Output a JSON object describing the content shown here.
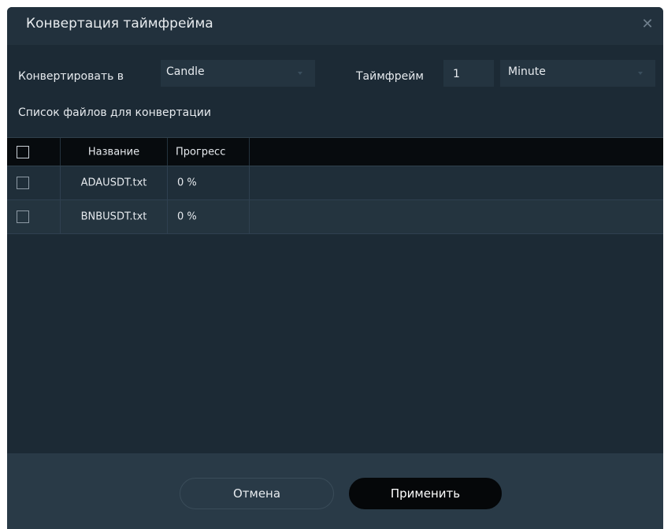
{
  "dialog": {
    "title": "Конвертация таймфрейма",
    "close_icon": "close-icon"
  },
  "convert": {
    "label": "Конвертировать в",
    "value": "Candle"
  },
  "timeframe": {
    "label": "Таймфрейм",
    "value": "1",
    "unit": "Minute"
  },
  "files_label": "Список файлов для конвертации",
  "table": {
    "columns": [
      "",
      "Название",
      "Прогресс",
      ""
    ],
    "rows": [
      {
        "name": "ADAUSDT.txt",
        "progress": "0 %"
      },
      {
        "name": "BNBUSDT.txt",
        "progress": "0 %"
      }
    ]
  },
  "buttons": {
    "cancel": "Отмена",
    "apply": "Применить"
  },
  "colors": {
    "background": "#1c2a35",
    "titlebar": "#22313d",
    "header_row": "#070b0e",
    "apply_button": "#050709"
  }
}
